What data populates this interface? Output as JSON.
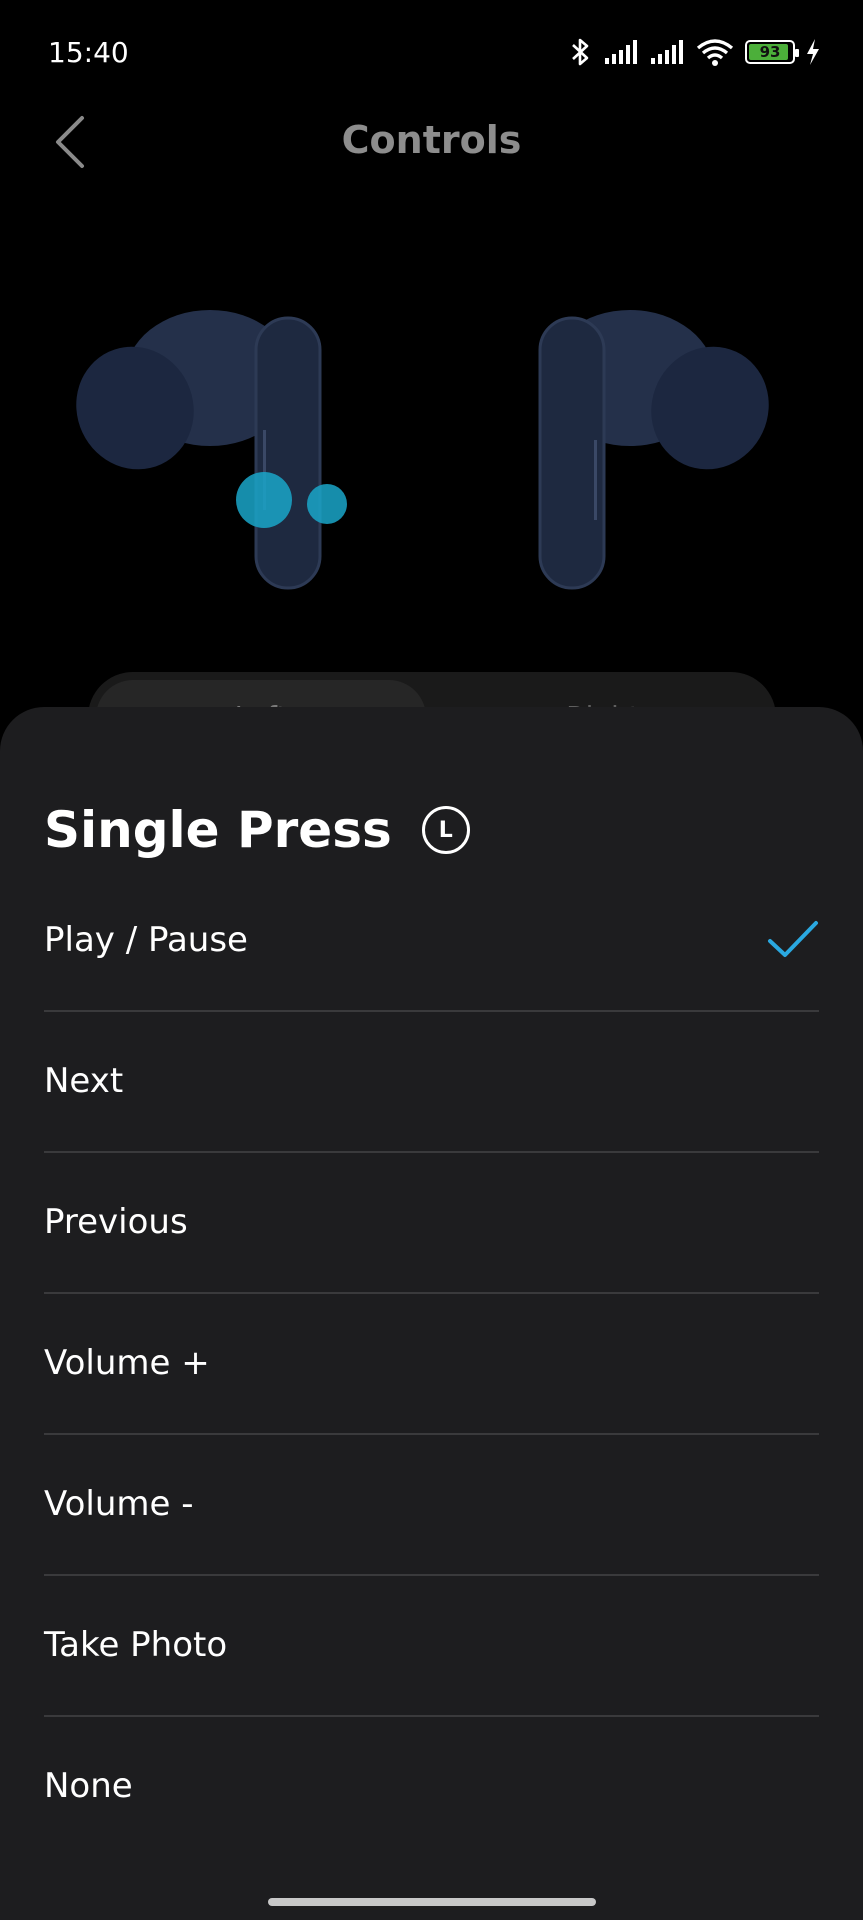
{
  "status_bar": {
    "time": "15:40",
    "battery_level": "93",
    "battery_color": "#4caf3a"
  },
  "header": {
    "title": "Controls",
    "back_icon": "chevron-left-icon"
  },
  "earbuds_image": {
    "color": "#1e2940",
    "highlight_color": "#1aa6c9"
  },
  "segment": {
    "left_label": "Left",
    "right_label": "Right",
    "selected": "Left"
  },
  "sheet": {
    "title": "Single Press",
    "side_badge": "L",
    "options": [
      {
        "label": "Play / Pause",
        "selected": true
      },
      {
        "label": "Next",
        "selected": false
      },
      {
        "label": "Previous",
        "selected": false
      },
      {
        "label": "Volume +",
        "selected": false
      },
      {
        "label": "Volume -",
        "selected": false
      },
      {
        "label": "Take Photo",
        "selected": false
      },
      {
        "label": "None",
        "selected": false
      }
    ],
    "check_color": "#2aa8e0"
  }
}
